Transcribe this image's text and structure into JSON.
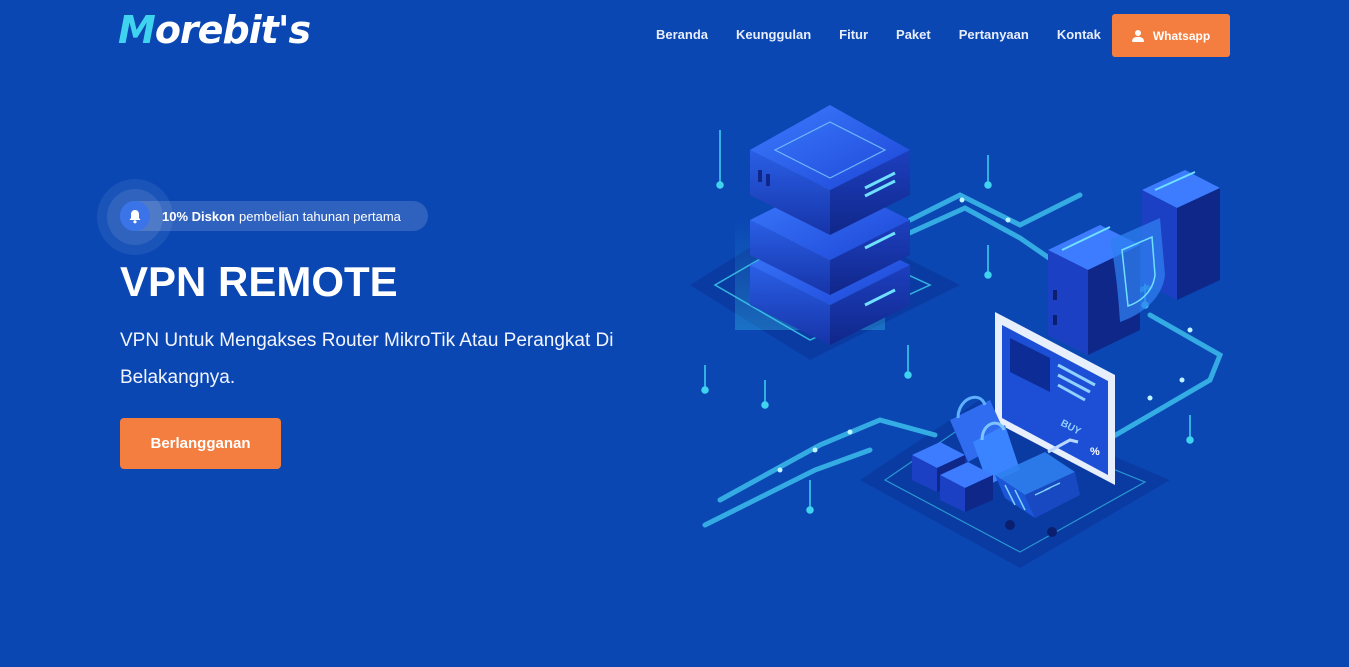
{
  "header": {
    "logo_initial": "M",
    "logo_rest": "orebit's",
    "nav": [
      "Beranda",
      "Keunggulan",
      "Fitur",
      "Paket",
      "Pertanyaan",
      "Kontak"
    ],
    "whatsapp_label": "Whatsapp"
  },
  "promo": {
    "highlight": "10% Diskon",
    "text": "pembelian tahunan pertama"
  },
  "hero": {
    "title": "VPN REMOTE",
    "subtitle": "VPN Untuk Mengakses Router MikroTik Atau Perangkat Di Belakangnya.",
    "cta_label": "Berlangganan"
  },
  "illustration": {
    "screen_label": "BUY",
    "screen_badge": "%"
  },
  "colors": {
    "background": "#0a47b3",
    "accent": "#f47e3f",
    "logo_accent": "#3fd3f0"
  }
}
